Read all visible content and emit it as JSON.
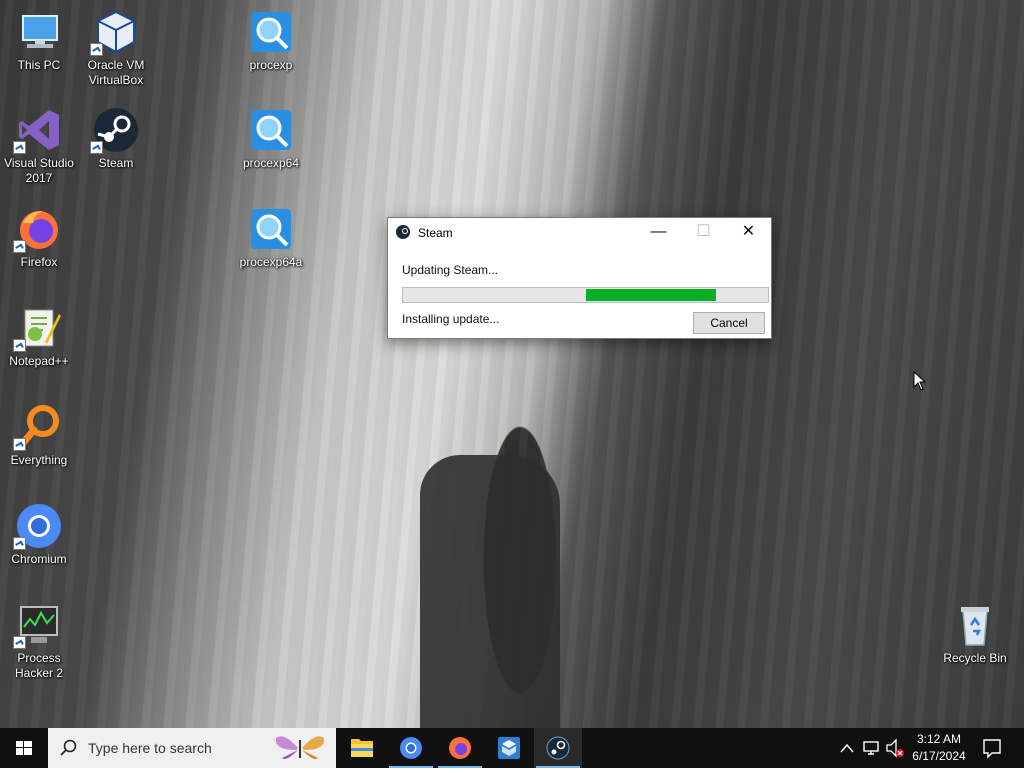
{
  "desktop_icons": [
    {
      "id": "this-pc",
      "label": "This PC"
    },
    {
      "id": "virtualbox",
      "label": "Oracle VM VirtualBox"
    },
    {
      "id": "procexp",
      "label": "procexp"
    },
    {
      "id": "visual-studio",
      "label": "Visual Studio 2017"
    },
    {
      "id": "steam",
      "label": "Steam"
    },
    {
      "id": "procexp64",
      "label": "procexp64"
    },
    {
      "id": "firefox",
      "label": "Firefox"
    },
    {
      "id": "procexp64a",
      "label": "procexp64a"
    },
    {
      "id": "notepadpp",
      "label": "Notepad++"
    },
    {
      "id": "everything",
      "label": "Everything"
    },
    {
      "id": "chromium",
      "label": "Chromium"
    },
    {
      "id": "process-hacker",
      "label": "Process Hacker 2"
    },
    {
      "id": "recycle-bin",
      "label": "Recycle Bin"
    }
  ],
  "dialog": {
    "title": "Steam",
    "status_text": "Updating Steam...",
    "progress": {
      "start_fraction": 0.5,
      "end_fraction": 0.855
    },
    "detail_text": "Installing update...",
    "cancel_label": "Cancel",
    "minimize_glyph": "—",
    "maximize_glyph": "☐",
    "close_glyph": "✕"
  },
  "taskbar": {
    "search_placeholder": "Type here to search",
    "apps": [
      "file-explorer",
      "chromium",
      "firefox",
      "virtualbox",
      "steam"
    ],
    "active_app": "steam",
    "clock": {
      "time": "3:12 AM",
      "date": "6/17/2024"
    }
  },
  "colors": {
    "progress_fill": "#06b025",
    "taskbar_bg": "#101010",
    "active_indicator": "#76b9ed"
  }
}
